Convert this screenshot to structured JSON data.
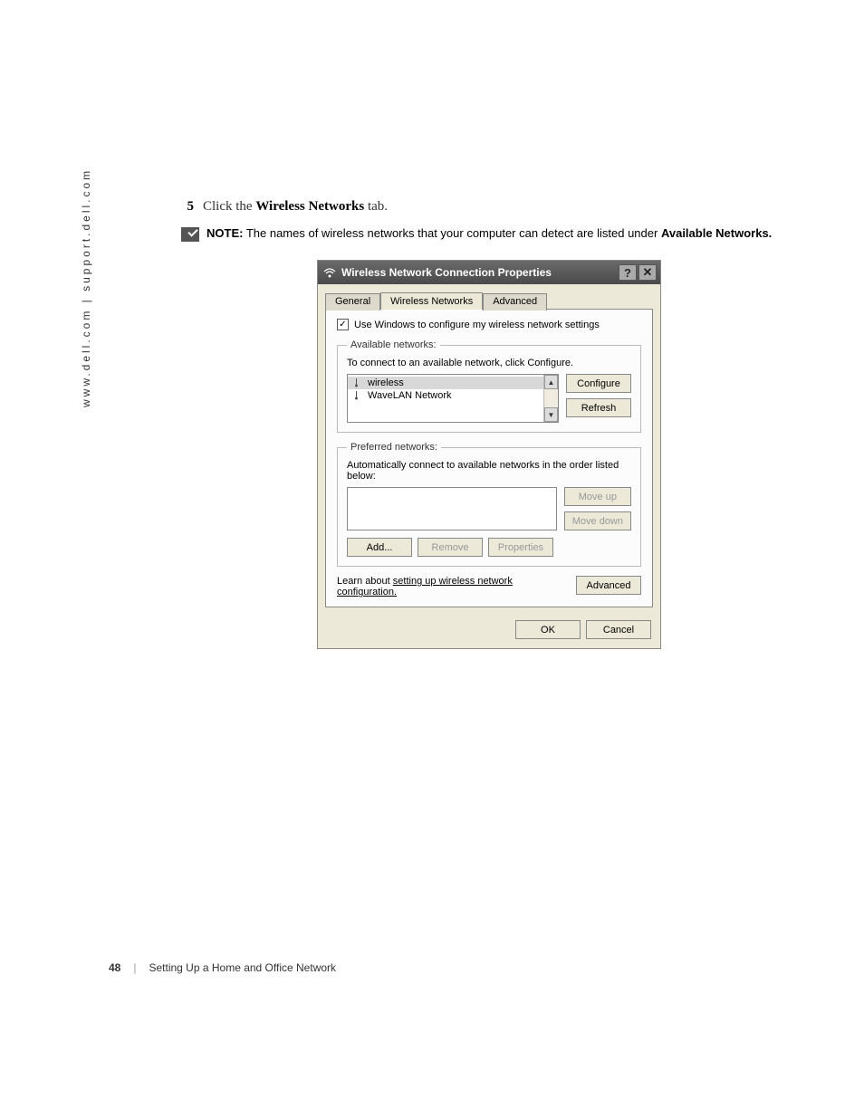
{
  "sidebar": {
    "text": "www.dell.com | support.dell.com"
  },
  "step": {
    "number": "5",
    "prefix": "Click the ",
    "bold": "Wireless Networks",
    "suffix": " tab."
  },
  "note": {
    "label": "NOTE:",
    "prefix": " The names of wireless networks that your computer can detect are listed under ",
    "bold": "Available Networks.",
    "suffix": ""
  },
  "dialog": {
    "title": "Wireless Network Connection Properties",
    "help": "?",
    "close": "✕",
    "tabs": {
      "general": "General",
      "wireless": "Wireless Networks",
      "advanced": "Advanced"
    },
    "checkbox": {
      "checked": "✓",
      "label": "Use Windows to configure my wireless network settings"
    },
    "available": {
      "legend": "Available networks:",
      "desc": "To connect to an available network, click Configure.",
      "items": [
        "wireless",
        "WaveLAN Network"
      ],
      "configure": "Configure",
      "refresh": "Refresh"
    },
    "preferred": {
      "legend": "Preferred networks:",
      "desc": "Automatically connect to available networks in the order listed below:",
      "moveup": "Move up",
      "movedown": "Move down",
      "add": "Add...",
      "remove": "Remove",
      "properties": "Properties"
    },
    "learn": {
      "prefix": "Learn about ",
      "link": "setting up wireless network configuration.",
      "advanced": "Advanced"
    },
    "footer": {
      "ok": "OK",
      "cancel": "Cancel"
    }
  },
  "page_footer": {
    "page": "48",
    "section": "Setting Up a Home and Office Network"
  }
}
